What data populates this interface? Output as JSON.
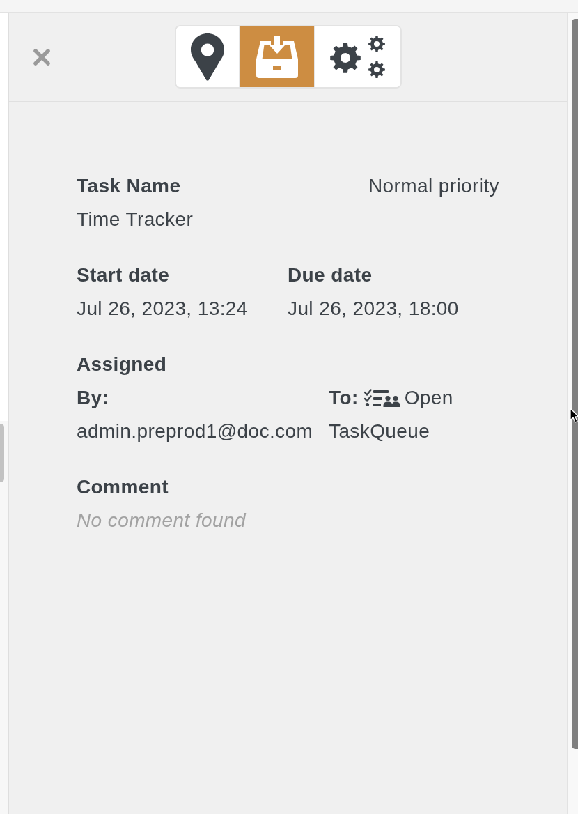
{
  "tabs": [
    {
      "kind": "location",
      "selected": false
    },
    {
      "kind": "inbox",
      "selected": true
    },
    {
      "kind": "settings",
      "selected": false
    }
  ],
  "task": {
    "name_label": "Task Name",
    "name": "Time Tracker",
    "priority": "Normal priority"
  },
  "dates": [
    {
      "label": "Start date",
      "value": "Jul 26, 2023, 13:24"
    },
    {
      "label": "Due date",
      "value": "Jul 26, 2023, 18:00"
    }
  ],
  "assigned": {
    "title": "Assigned",
    "by": {
      "label": "By:",
      "value": "admin.preprod1@doc.com"
    },
    "to": {
      "label": "To:",
      "value_lines": [
        "Open",
        "TaskQueue"
      ]
    }
  },
  "comment": {
    "label": "Comment",
    "empty_message": "No comment found"
  }
}
